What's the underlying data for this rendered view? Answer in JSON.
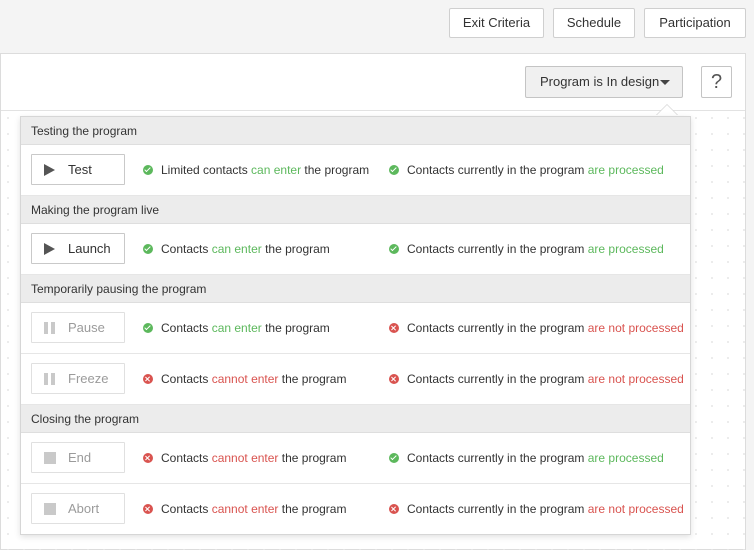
{
  "toolbar": {
    "exit_criteria": "Exit Criteria",
    "schedule": "Schedule",
    "participation": "Participation"
  },
  "status": {
    "label": "Program is In design",
    "help": "?"
  },
  "colors": {
    "ok": "#5cb85c",
    "bad": "#d9534f"
  },
  "sections": [
    {
      "title": "Testing the program",
      "rows": [
        {
          "action": "Test",
          "icon": "play-icon",
          "enabled": true,
          "enter": {
            "status": "ok",
            "pre": "Limited contacts ",
            "hl": "can enter",
            "post": " the program"
          },
          "process": {
            "status": "ok",
            "pre": "Contacts currently in the program ",
            "hl": "are processed"
          }
        }
      ]
    },
    {
      "title": "Making the program live",
      "rows": [
        {
          "action": "Launch",
          "icon": "play-icon",
          "enabled": true,
          "enter": {
            "status": "ok",
            "pre": "Contacts ",
            "hl": "can enter",
            "post": " the program"
          },
          "process": {
            "status": "ok",
            "pre": "Contacts currently in the program ",
            "hl": "are processed"
          }
        }
      ]
    },
    {
      "title": "Temporarily pausing the program",
      "rows": [
        {
          "action": "Pause",
          "icon": "pause-icon",
          "enabled": false,
          "enter": {
            "status": "ok",
            "pre": "Contacts ",
            "hl": "can enter",
            "post": " the program"
          },
          "process": {
            "status": "bad",
            "pre": "Contacts currently in the program ",
            "hl": "are not processed"
          }
        },
        {
          "action": "Freeze",
          "icon": "pause-icon",
          "enabled": false,
          "enter": {
            "status": "bad",
            "pre": "Contacts ",
            "hl": "cannot enter",
            "post": " the program"
          },
          "process": {
            "status": "bad",
            "pre": "Contacts currently in the program ",
            "hl": "are not processed"
          }
        }
      ]
    },
    {
      "title": "Closing the program",
      "rows": [
        {
          "action": "End",
          "icon": "stop-icon",
          "enabled": false,
          "enter": {
            "status": "bad",
            "pre": "Contacts ",
            "hl": "cannot enter",
            "post": " the program"
          },
          "process": {
            "status": "ok",
            "pre": "Contacts currently in the program ",
            "hl": "are processed"
          }
        },
        {
          "action": "Abort",
          "icon": "stop-icon",
          "enabled": false,
          "enter": {
            "status": "bad",
            "pre": "Contacts ",
            "hl": "cannot enter",
            "post": " the program"
          },
          "process": {
            "status": "bad",
            "pre": "Contacts currently in the program ",
            "hl": "are not processed"
          }
        }
      ]
    }
  ]
}
